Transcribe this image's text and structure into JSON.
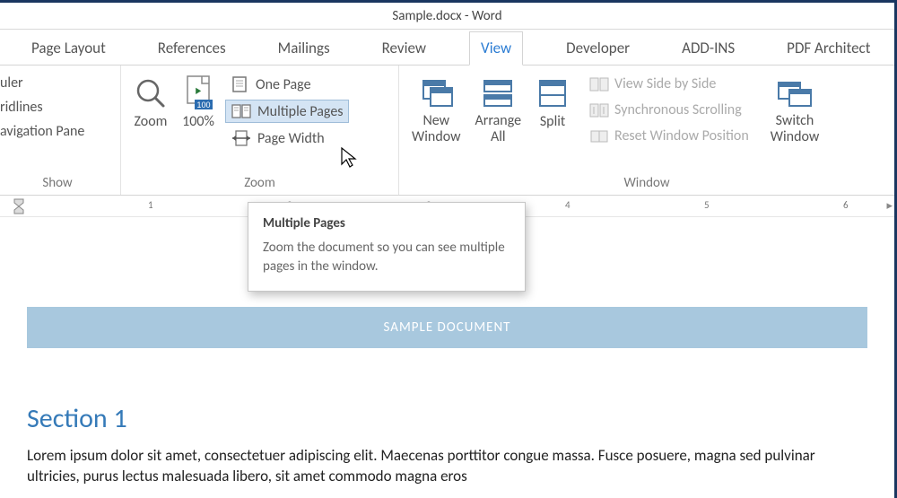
{
  "title": "Sample.docx - Word",
  "tabs": [
    "Page Layout",
    "References",
    "Mailings",
    "Review",
    "View",
    "Developer",
    "ADD-INS",
    "PDF Architect"
  ],
  "activeTab": "View",
  "show": {
    "ruler": "uler",
    "gridlines": "ridlines",
    "navpane": "avigation Pane",
    "label": "Show"
  },
  "zoom": {
    "zoom": "Zoom",
    "p100": "100%",
    "one": "One Page",
    "multi": "Multiple Pages",
    "width": "Page Width",
    "label": "Zoom"
  },
  "window": {
    "new": "New Window",
    "arrange": "Arrange All",
    "split": "Split",
    "side": "View Side by Side",
    "sync": "Synchronous Scrolling",
    "reset": "Reset Window Position",
    "switch": "Switch Windows",
    "label": "Window"
  },
  "ruler": {
    "nums": [
      "1",
      "2",
      "3",
      "4",
      "5",
      "6"
    ]
  },
  "tooltip": {
    "title": "Multiple Pages",
    "body": "Zoom the document so you can see multiple pages in the window."
  },
  "doc": {
    "banner": "SAMPLE DOCUMENT",
    "h1": "Section 1",
    "p": "Lorem ipsum dolor sit amet, consectetuer adipiscing elit. Maecenas porttitor congue massa. Fusce posuere, magna sed pulvinar ultricies, purus lectus malesuada libero, sit amet commodo magna eros"
  }
}
